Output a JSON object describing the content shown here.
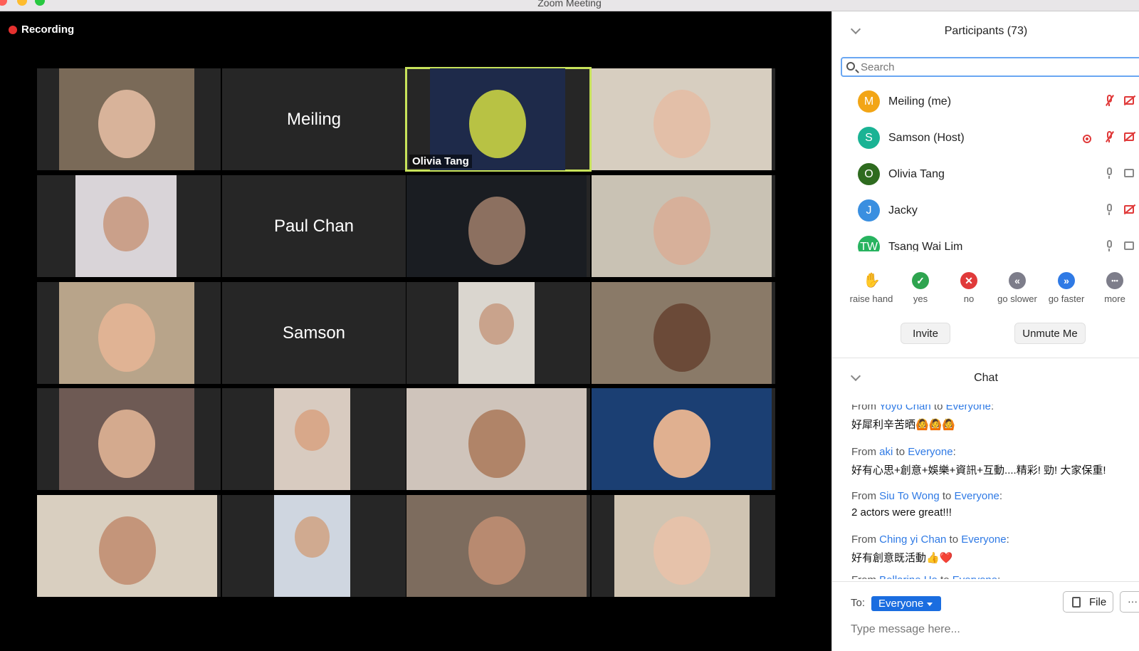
{
  "window": {
    "title": "Zoom Meeting"
  },
  "recording": {
    "label": "Recording"
  },
  "tiles": [
    {
      "name": ""
    },
    {
      "name": "Meiling"
    },
    {
      "name": "Olivia Tang"
    },
    {
      "name": ""
    },
    {
      "name": ""
    },
    {
      "name": "Paul Chan"
    },
    {
      "name": ""
    },
    {
      "name": ""
    },
    {
      "name": ""
    },
    {
      "name": "Samson"
    },
    {
      "name": ""
    },
    {
      "name": ""
    },
    {
      "name": ""
    },
    {
      "name": ""
    },
    {
      "name": ""
    },
    {
      "name": ""
    },
    {
      "name": ""
    },
    {
      "name": ""
    },
    {
      "name": ""
    },
    {
      "name": ""
    }
  ],
  "participants": {
    "title": "Participants (73)",
    "search_placeholder": "Search",
    "list": [
      {
        "initial": "M",
        "name": "Meiling (me)",
        "color": "#f2a516",
        "mic": "muted",
        "cam": "off"
      },
      {
        "initial": "S",
        "name": "Samson (Host)",
        "color": "#1ab394",
        "mic": "muted",
        "cam": "off",
        "recording": true
      },
      {
        "initial": "O",
        "name": "Olivia Tang",
        "color": "#2e6b1f",
        "mic": "on",
        "cam": "on"
      },
      {
        "initial": "J",
        "name": "Jacky",
        "color": "#3a8fe0",
        "mic": "on",
        "cam": "off"
      },
      {
        "initial": "TW",
        "name": "Tsang Wai Lim",
        "color": "#27b35f",
        "mic": "on",
        "cam": "on"
      }
    ],
    "reactions": [
      {
        "label": "raise hand",
        "icon": "raise-hand-icon",
        "glyph": "✋",
        "color": "#2f7ae5"
      },
      {
        "label": "yes",
        "icon": "check-icon",
        "glyph": "✓",
        "color": "#2ea44f"
      },
      {
        "label": "no",
        "icon": "x-icon",
        "glyph": "✕",
        "color": "#e03a3a"
      },
      {
        "label": "go slower",
        "icon": "rewind-icon",
        "glyph": "«",
        "color": "#7d7d8a"
      },
      {
        "label": "go faster",
        "icon": "fast-forward-icon",
        "glyph": "»",
        "color": "#2f7ae5"
      },
      {
        "label": "more",
        "icon": "more-icon",
        "glyph": "•••",
        "color": "#7d7d8a"
      }
    ],
    "invite_label": "Invite",
    "unmute_label": "Unmute Me"
  },
  "chat": {
    "title": "Chat",
    "messages": [
      {
        "from": "Yoyo Chan",
        "to": "Everyone",
        "text": "好犀利辛苦晒🙆🙆🙆"
      },
      {
        "from": "aki",
        "to": "Everyone",
        "text": "好有心思+創意+娛樂+資訊+互動....精彩! 勁! 大家保重!"
      },
      {
        "from": "Siu To Wong",
        "to": "Everyone",
        "text": "2 actors were great!!!"
      },
      {
        "from": "Ching yi Chan",
        "to": "Everyone",
        "text": "好有創意既活動👍❤️"
      },
      {
        "from": "Bellarine Ho",
        "to": "Everyone",
        "text": ""
      }
    ],
    "from_word": "From",
    "to_word": "to",
    "to_label": "To:",
    "recipient": "Everyone",
    "file_label": "File",
    "more_label": "···",
    "input_placeholder": "Type message here..."
  }
}
